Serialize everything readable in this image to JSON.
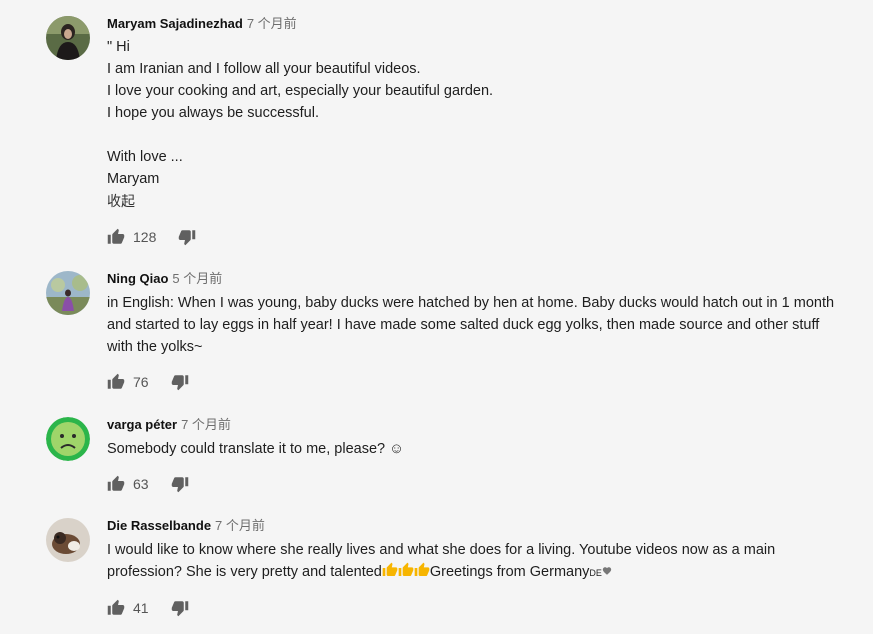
{
  "comments": [
    {
      "author": "Maryam Sajadinezhad",
      "time": "7 个月前",
      "lines": [
        "\" Hi",
        "I am Iranian and I follow all your beautiful videos.",
        "I love your cooking and art, especially your beautiful garden.",
        "I hope you always be successful.",
        "",
        "With love ...",
        "Maryam"
      ],
      "collapse_label": "收起",
      "likes": "128"
    },
    {
      "author": "Ning Qiao",
      "time": "5 个月前",
      "text": "in English: When I was young, baby ducks were hatched by hen at home. Baby ducks would hatch out in 1 month and started to lay eggs in half year! I have made some salted duck egg yolks, then made source and other stuff with the yolks~",
      "likes": "76"
    },
    {
      "author": "varga péter",
      "time": "7 个月前",
      "text": "Somebody could translate it to me, please? ☺",
      "likes": "63"
    },
    {
      "author": "Die Rasselbande",
      "time": "7 个月前",
      "text_before": "I would like to know where she really lives and what she does for a living. Youtube videos now as a main profession? She is very pretty and talented",
      "text_after": "Greetings from Germany",
      "flag_text": "DE",
      "likes": "41"
    }
  ],
  "icons": {
    "like": "thumbs-up-icon",
    "dislike": "thumbs-down-icon"
  }
}
